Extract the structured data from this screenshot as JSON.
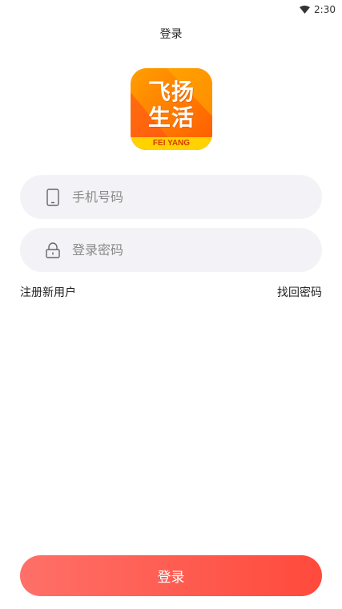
{
  "status_bar": {
    "time": "2:30"
  },
  "header": {
    "title": "登录"
  },
  "logo": {
    "line1": "飞扬",
    "line2": "生活",
    "band": "FEI YANG"
  },
  "form": {
    "phone_placeholder": "手机号码",
    "password_placeholder": "登录密码"
  },
  "links": {
    "register": "注册新用户",
    "forgot": "找回密码"
  },
  "login_button": "登录",
  "colors": {
    "accent_start": "#ff7068",
    "accent_end": "#ff4a3c",
    "field_bg": "#f3f3f7",
    "logo_orange": "#ff8a00",
    "logo_band": "#ffd200"
  }
}
